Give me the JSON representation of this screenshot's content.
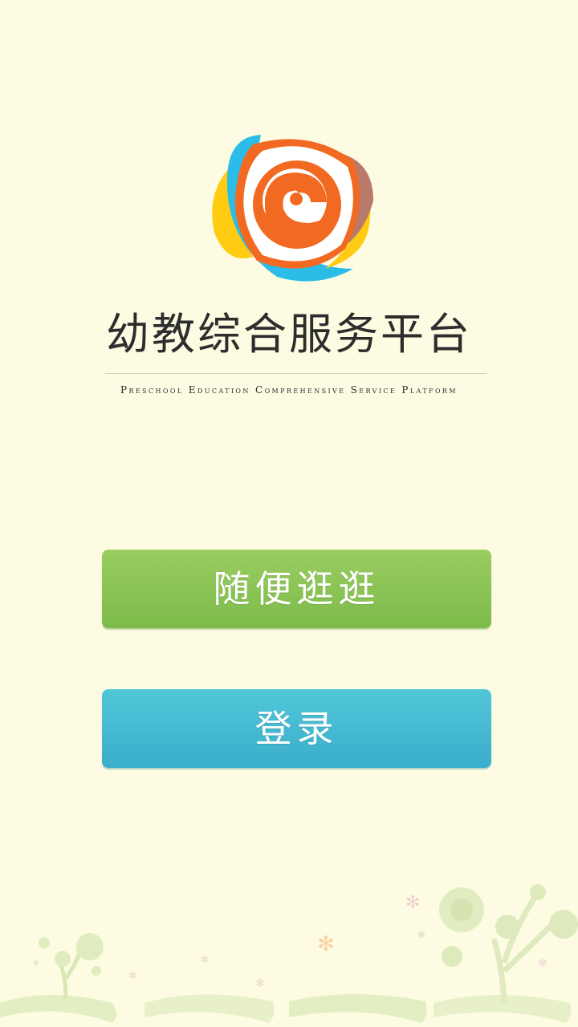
{
  "app": {
    "title": "幼教综合服务平台",
    "subtitle": "Preschool Education Comprehensive Service Platform"
  },
  "buttons": {
    "browse_label": "随便逛逛",
    "login_label": "登录"
  },
  "icons": {
    "logo": "app-logo-icon",
    "decoration": "tree-decoration-icon"
  },
  "colors": {
    "background": "#fdfce3",
    "browse_button": "#8cc455",
    "login_button": "#45b9d1",
    "logo_orange": "#f26a22",
    "logo_yellow": "#ffcc11",
    "logo_cyan": "#2bbce8",
    "logo_green": "#9cc95a"
  }
}
